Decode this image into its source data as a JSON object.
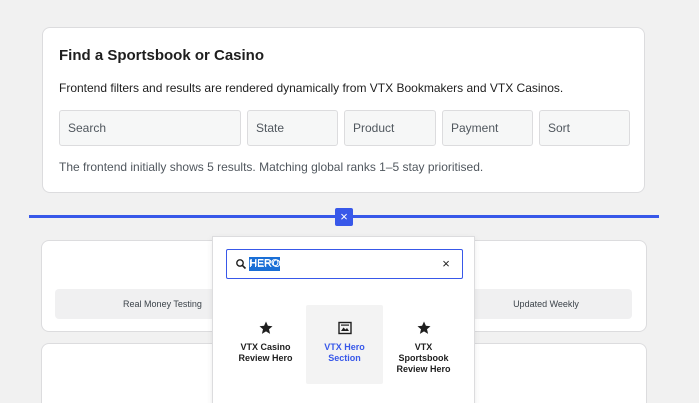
{
  "finder": {
    "title": "Find a Sportsbook or Casino",
    "description": "Frontend filters and results are rendered dynamically from VTX Bookmakers and VTX Casinos.",
    "filters": [
      {
        "label": "Search"
      },
      {
        "label": "State"
      },
      {
        "label": "Product"
      },
      {
        "label": "Payment"
      },
      {
        "label": "Sort"
      }
    ],
    "note": "The frontend initially shows 5 results. Matching global ranks 1–5 stay prioritised."
  },
  "insertion_point": {
    "close_icon": "×"
  },
  "trust_bar": {
    "items": [
      {
        "label": "Real Money Testing"
      },
      {
        "label": "Updated Weekly"
      }
    ]
  },
  "inserter": {
    "search": {
      "value": "HERO",
      "clear_icon": "×"
    },
    "results": [
      {
        "label": "VTX Casino Review Hero",
        "icon": "star-icon"
      },
      {
        "label": "VTX Hero Section",
        "icon": "cover-image-icon"
      },
      {
        "label": "VTX Sportsbook Review Hero",
        "icon": "star-icon"
      }
    ]
  },
  "colors": {
    "accent": "#3858e9",
    "selection": "#1a6fd6",
    "card_border": "#dcdcde"
  }
}
